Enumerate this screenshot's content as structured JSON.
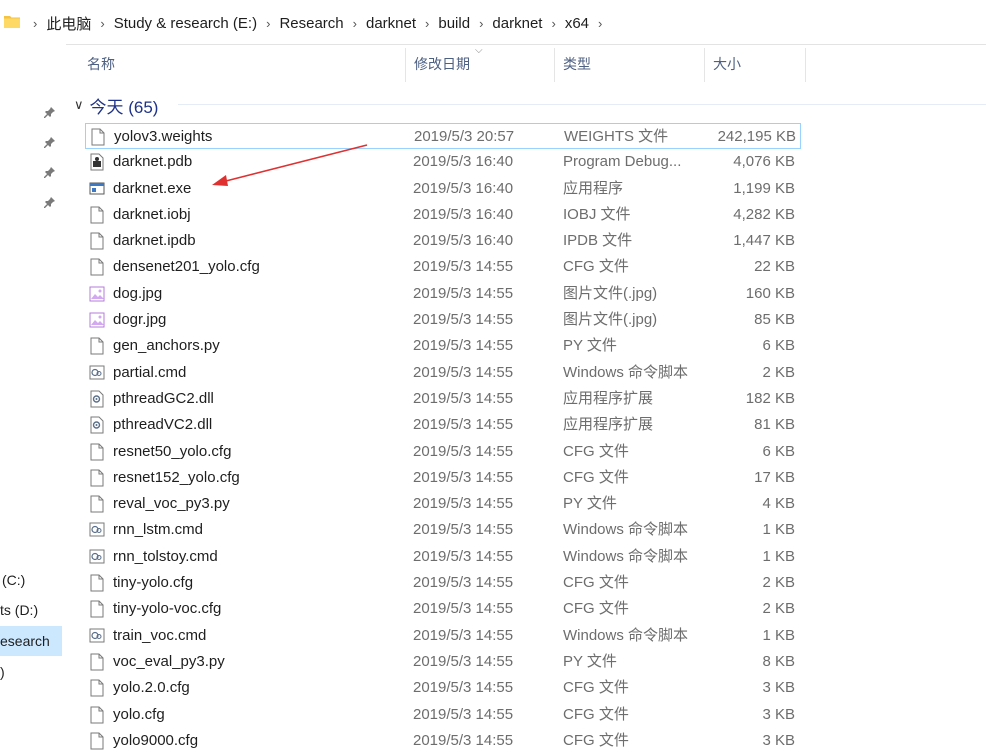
{
  "breadcrumb": [
    "此电脑",
    "Study & research (E:)",
    "Research",
    "darknet",
    "build",
    "darknet",
    "x64"
  ],
  "columns": {
    "name": "名称",
    "date": "修改日期",
    "type": "类型",
    "size": "大小"
  },
  "group": {
    "label": "今天 (65)"
  },
  "nav": {
    "drive_c": "(C:)",
    "drive_d": "ts (D:)",
    "drive_e": "esearch",
    "extra": ")"
  },
  "files": [
    {
      "name": "yolov3.weights",
      "date": "2019/5/3 20:57",
      "type": "WEIGHTS 文件",
      "size": "242,195 KB",
      "icon": "file-icon"
    },
    {
      "name": "darknet.pdb",
      "date": "2019/5/3 16:40",
      "type": "Program Debug...",
      "size": "4,076 KB",
      "icon": "pdb-icon"
    },
    {
      "name": "darknet.exe",
      "date": "2019/5/3 16:40",
      "type": "应用程序",
      "size": "1,199 KB",
      "icon": "exe-icon"
    },
    {
      "name": "darknet.iobj",
      "date": "2019/5/3 16:40",
      "type": "IOBJ 文件",
      "size": "4,282 KB",
      "icon": "file-icon"
    },
    {
      "name": "darknet.ipdb",
      "date": "2019/5/3 16:40",
      "type": "IPDB 文件",
      "size": "1,447 KB",
      "icon": "file-icon"
    },
    {
      "name": "densenet201_yolo.cfg",
      "date": "2019/5/3 14:55",
      "type": "CFG 文件",
      "size": "22 KB",
      "icon": "file-icon"
    },
    {
      "name": "dog.jpg",
      "date": "2019/5/3 14:55",
      "type": "图片文件(.jpg)",
      "size": "160 KB",
      "icon": "image-icon"
    },
    {
      "name": "dogr.jpg",
      "date": "2019/5/3 14:55",
      "type": "图片文件(.jpg)",
      "size": "85 KB",
      "icon": "image-icon"
    },
    {
      "name": "gen_anchors.py",
      "date": "2019/5/3 14:55",
      "type": "PY 文件",
      "size": "6 KB",
      "icon": "file-icon"
    },
    {
      "name": "partial.cmd",
      "date": "2019/5/3 14:55",
      "type": "Windows 命令脚本",
      "size": "2 KB",
      "icon": "cmd-icon"
    },
    {
      "name": "pthreadGC2.dll",
      "date": "2019/5/3 14:55",
      "type": "应用程序扩展",
      "size": "182 KB",
      "icon": "dll-icon"
    },
    {
      "name": "pthreadVC2.dll",
      "date": "2019/5/3 14:55",
      "type": "应用程序扩展",
      "size": "81 KB",
      "icon": "dll-icon"
    },
    {
      "name": "resnet50_yolo.cfg",
      "date": "2019/5/3 14:55",
      "type": "CFG 文件",
      "size": "6 KB",
      "icon": "file-icon"
    },
    {
      "name": "resnet152_yolo.cfg",
      "date": "2019/5/3 14:55",
      "type": "CFG 文件",
      "size": "17 KB",
      "icon": "file-icon"
    },
    {
      "name": "reval_voc_py3.py",
      "date": "2019/5/3 14:55",
      "type": "PY 文件",
      "size": "4 KB",
      "icon": "file-icon"
    },
    {
      "name": "rnn_lstm.cmd",
      "date": "2019/5/3 14:55",
      "type": "Windows 命令脚本",
      "size": "1 KB",
      "icon": "cmd-icon"
    },
    {
      "name": "rnn_tolstoy.cmd",
      "date": "2019/5/3 14:55",
      "type": "Windows 命令脚本",
      "size": "1 KB",
      "icon": "cmd-icon"
    },
    {
      "name": "tiny-yolo.cfg",
      "date": "2019/5/3 14:55",
      "type": "CFG 文件",
      "size": "2 KB",
      "icon": "file-icon"
    },
    {
      "name": "tiny-yolo-voc.cfg",
      "date": "2019/5/3 14:55",
      "type": "CFG 文件",
      "size": "2 KB",
      "icon": "file-icon"
    },
    {
      "name": "train_voc.cmd",
      "date": "2019/5/3 14:55",
      "type": "Windows 命令脚本",
      "size": "1 KB",
      "icon": "cmd-icon"
    },
    {
      "name": "voc_eval_py3.py",
      "date": "2019/5/3 14:55",
      "type": "PY 文件",
      "size": "8 KB",
      "icon": "file-icon"
    },
    {
      "name": "yolo.2.0.cfg",
      "date": "2019/5/3 14:55",
      "type": "CFG 文件",
      "size": "3 KB",
      "icon": "file-icon"
    },
    {
      "name": "yolo.cfg",
      "date": "2019/5/3 14:55",
      "type": "CFG 文件",
      "size": "3 KB",
      "icon": "file-icon"
    },
    {
      "name": "yolo9000.cfg",
      "date": "2019/5/3 14:55",
      "type": "CFG 文件",
      "size": "3 KB",
      "icon": "file-icon"
    }
  ],
  "colors": {
    "annotation_arrow": "#e03131",
    "group_header": "#1e3287",
    "selection_border": "#99d1ff"
  }
}
